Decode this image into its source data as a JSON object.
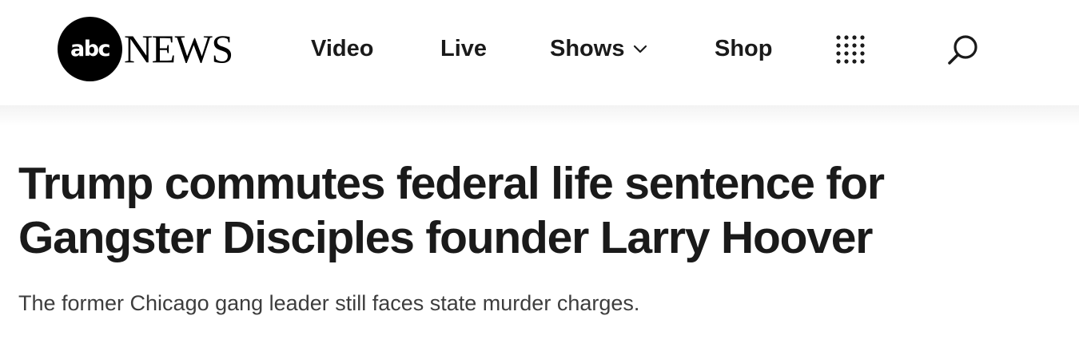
{
  "header": {
    "logo": {
      "brand_mark": "abc",
      "wordmark": "NEWS"
    },
    "nav": {
      "video": "Video",
      "live": "Live",
      "shows": "Shows",
      "shop": "Shop"
    },
    "icons": {
      "shows_dropdown": "chevron-down-icon",
      "apps": "grid-dots-icon",
      "search": "search-icon"
    }
  },
  "article": {
    "headline": "Trump commutes federal life sentence for Gangster Disciples founder Larry Hoover",
    "subheadline": "The former Chicago gang leader still faces state murder charges."
  }
}
